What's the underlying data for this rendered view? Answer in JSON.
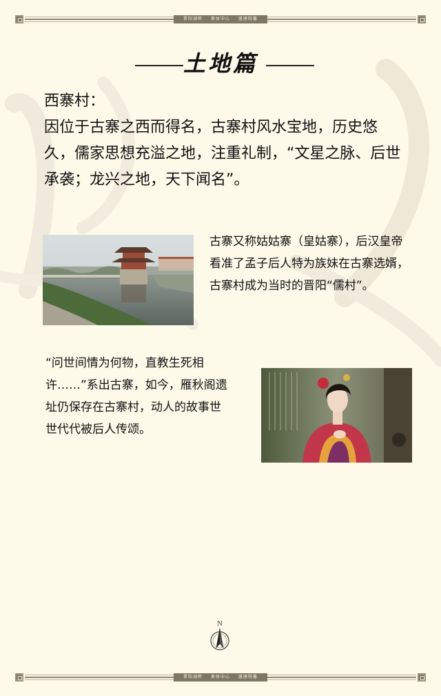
{
  "header_bar": {
    "segments": [
      "晋阳湖畔",
      "奥体中心",
      "盛唐院蕃"
    ]
  },
  "heading": {
    "title": "土地篇"
  },
  "intro": {
    "label": "西寨村：",
    "body": "因位于古寨之西而得名，古寨村风水宝地，历史悠久，儒家思想充溢之地，注重礼制，“文星之脉、后世承袭；龙兴之地，天下闻名”。"
  },
  "section1": {
    "text": "古寨又称姑姑寨（皇姑寨），后汉皇帝看准了孟子后人特为族妹在古寨选婿，古寨村成为当时的晋阳“儒村”。"
  },
  "section2": {
    "text": "“问世间情为何物，直教生死相许……”系出古寨，如今，雁秋阁遗址仍保存在古寨村，动人的故事世世代代被后人传颂。"
  },
  "compass": {
    "letter": "N"
  },
  "footer_bar": {
    "segments": [
      "晋阳湖畔",
      "奥体中心",
      "盛唐院蕃"
    ]
  }
}
